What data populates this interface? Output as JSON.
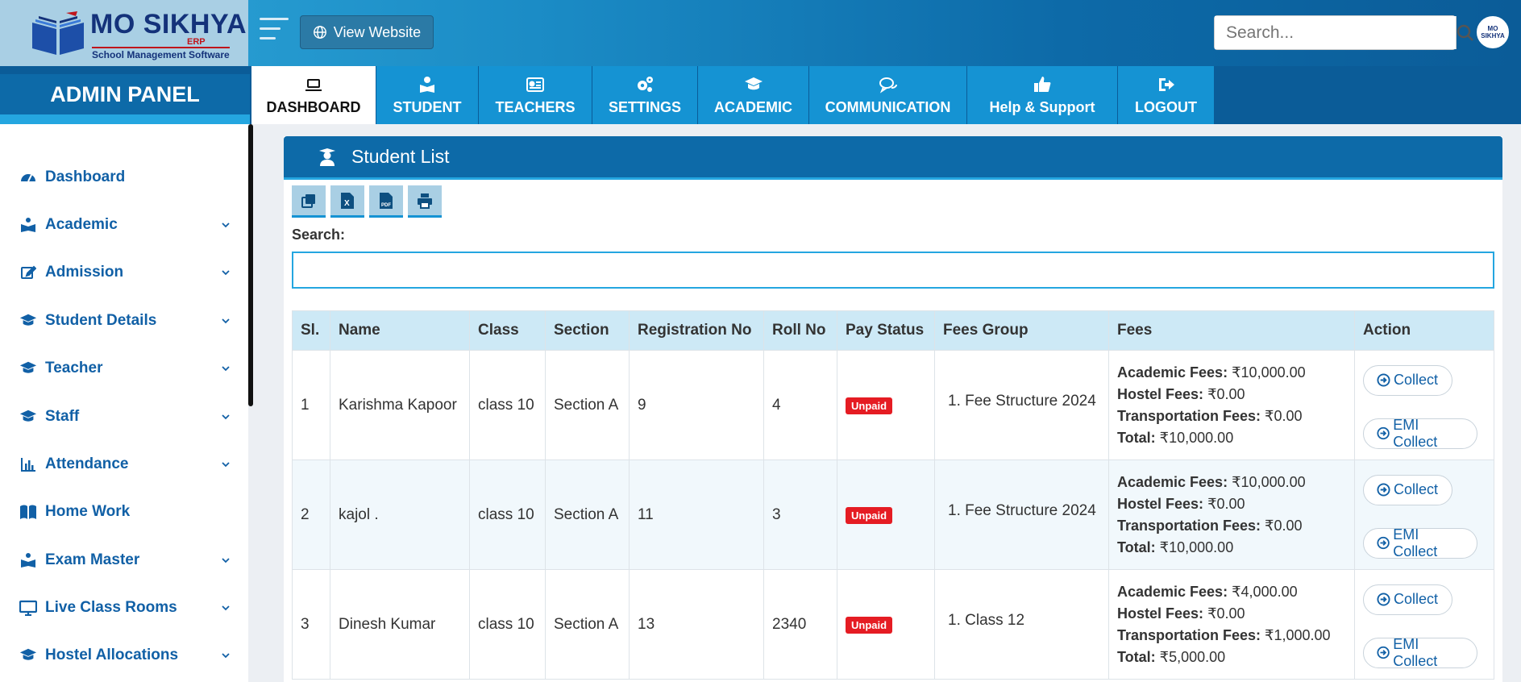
{
  "brand": {
    "title": "MO SIKHYA",
    "erp": "ERP",
    "subtitle": "School Management Software",
    "avatar_text": "MO SIKHYA"
  },
  "header": {
    "view_website": "View Website",
    "search_placeholder": "Search..."
  },
  "admin_panel": "ADMIN PANEL",
  "tabs": [
    {
      "label": "DASHBOARD",
      "icon": "laptop-icon"
    },
    {
      "label": "STUDENT",
      "icon": "student-icon"
    },
    {
      "label": "TEACHERS",
      "icon": "id-card-icon"
    },
    {
      "label": "SETTINGS",
      "icon": "gears-icon"
    },
    {
      "label": "ACADEMIC",
      "icon": "graduation-cap-icon"
    },
    {
      "label": "COMMUNICATION",
      "icon": "chat-icon"
    },
    {
      "label": "Help & Support",
      "icon": "thumbs-up-icon"
    },
    {
      "label": "LOGOUT",
      "icon": "sign-out-icon"
    }
  ],
  "sidebar": {
    "items": [
      {
        "label": "Dashboard",
        "icon": "dashboard-icon",
        "expandable": false
      },
      {
        "label": "Academic",
        "icon": "reader-icon",
        "expandable": true
      },
      {
        "label": "Admission",
        "icon": "edit-icon",
        "expandable": true
      },
      {
        "label": "Student Details",
        "icon": "graduation-cap-icon",
        "expandable": true
      },
      {
        "label": "Teacher",
        "icon": "graduation-cap-icon",
        "expandable": true
      },
      {
        "label": "Staff",
        "icon": "graduation-cap-icon",
        "expandable": true
      },
      {
        "label": "Attendance",
        "icon": "bar-chart-icon",
        "expandable": true
      },
      {
        "label": "Home Work",
        "icon": "book-icon",
        "expandable": false
      },
      {
        "label": "Exam Master",
        "icon": "reader-icon",
        "expandable": true
      },
      {
        "label": "Live Class Rooms",
        "icon": "monitor-icon",
        "expandable": true
      },
      {
        "label": "Hostel Allocations",
        "icon": "graduation-cap-icon",
        "expandable": true
      }
    ]
  },
  "panel": {
    "title": "Student List",
    "search_label": "Search:",
    "tools": [
      "copy-icon",
      "excel-icon",
      "pdf-icon",
      "print-icon"
    ]
  },
  "table": {
    "headers": [
      "Sl.",
      "Name",
      "Class",
      "Section",
      "Registration No",
      "Roll No",
      "Pay Status",
      "Fees Group",
      "Fees",
      "Action"
    ],
    "rows": [
      {
        "sl": "1",
        "name": "Karishma Kapoor",
        "class": "class 10",
        "section": "Section A",
        "reg": "9",
        "roll": "4",
        "status": "Unpaid",
        "group": "1. Fee Structure 2024",
        "academic": "₹10,000.00",
        "hostel": "₹0.00",
        "transport": "₹0.00",
        "total": "₹10,000.00"
      },
      {
        "sl": "2",
        "name": "kajol .",
        "class": "class 10",
        "section": "Section A",
        "reg": "11",
        "roll": "3",
        "status": "Unpaid",
        "group": "1. Fee Structure 2024",
        "academic": "₹10,000.00",
        "hostel": "₹0.00",
        "transport": "₹0.00",
        "total": "₹10,000.00"
      },
      {
        "sl": "3",
        "name": "Dinesh Kumar",
        "class": "class 10",
        "section": "Section A",
        "reg": "13",
        "roll": "2340",
        "status": "Unpaid",
        "group": "1. Class 12",
        "academic": "₹4,000.00",
        "hostel": "₹0.00",
        "transport": "₹1,000.00",
        "total": "₹5,000.00"
      }
    ],
    "fee_labels": {
      "academic": "Academic Fees:",
      "hostel": "Hostel Fees:",
      "transport": "Transportation Fees:",
      "total": "Total:"
    },
    "actions": {
      "collect": "Collect",
      "emi": "EMI Collect"
    }
  },
  "colors": {
    "primary": "#0d6aa8",
    "accent": "#24a6e0",
    "tab": "#1593d3",
    "link": "#1160a6",
    "unpaid": "#e51c23"
  }
}
